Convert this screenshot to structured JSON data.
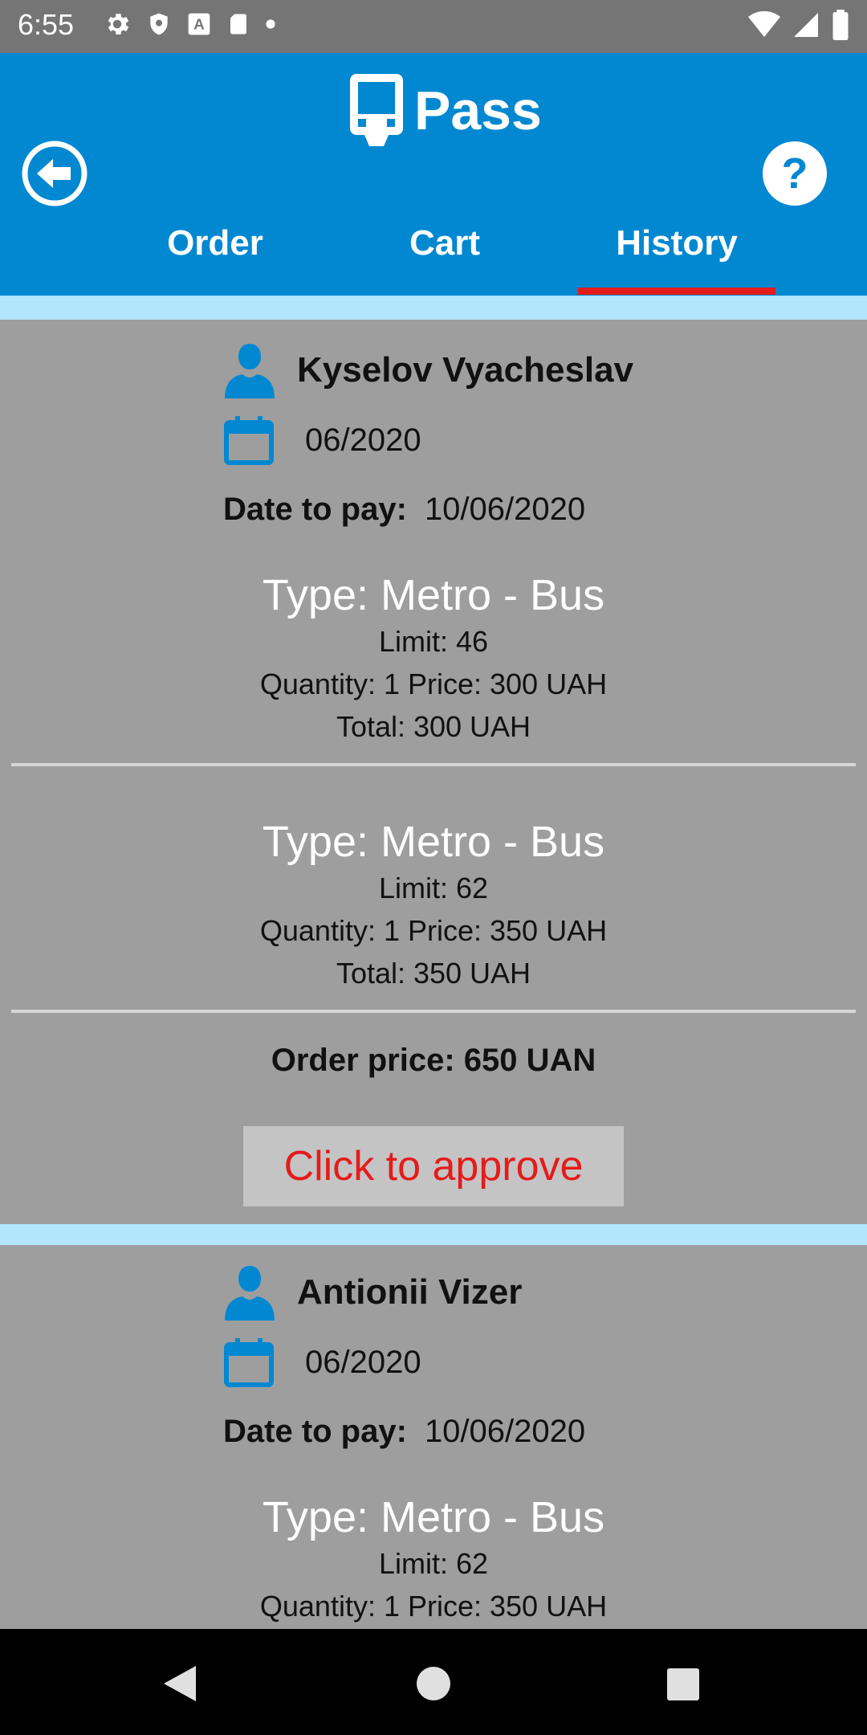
{
  "status_bar": {
    "time": "6:55",
    "icons": [
      "gear-icon",
      "shield-icon",
      "a-icon",
      "sd-card-icon",
      "dot-icon",
      "wifi-icon",
      "signal-icon",
      "battery-icon"
    ]
  },
  "header": {
    "title": "Pass",
    "tabs": [
      {
        "label": "Order"
      },
      {
        "label": "Cart"
      },
      {
        "label": "History",
        "active": true
      }
    ],
    "accent_color": "#0288d1",
    "indicator_color": "#e51b1b"
  },
  "orders": [
    {
      "name": "Kyselov Vyacheslav",
      "period": "06/2020",
      "date_to_pay_label": "Date to pay:",
      "date_to_pay": "10/06/2020",
      "items": [
        {
          "type": "Type: Metro - Bus",
          "limit": "Limit:  46",
          "qty_price": "Quantity:  1 Price:  300 UAH",
          "total": "Total: 300 UAH"
        },
        {
          "type": "Type: Metro - Bus",
          "limit": "Limit:  62",
          "qty_price": "Quantity:  1 Price:  350 UAH",
          "total": "Total: 350 UAH"
        }
      ],
      "order_price": "Order price: 650 UAN",
      "approve_label": "Click to approve"
    },
    {
      "name": "Antionii Vizer",
      "period": "06/2020",
      "date_to_pay_label": "Date to pay:",
      "date_to_pay": "10/06/2020",
      "items": [
        {
          "type": "Type: Metro - Bus",
          "limit": "Limit:  62",
          "qty_price": "Quantity:  1 Price:  350 UAH"
        }
      ]
    }
  ]
}
